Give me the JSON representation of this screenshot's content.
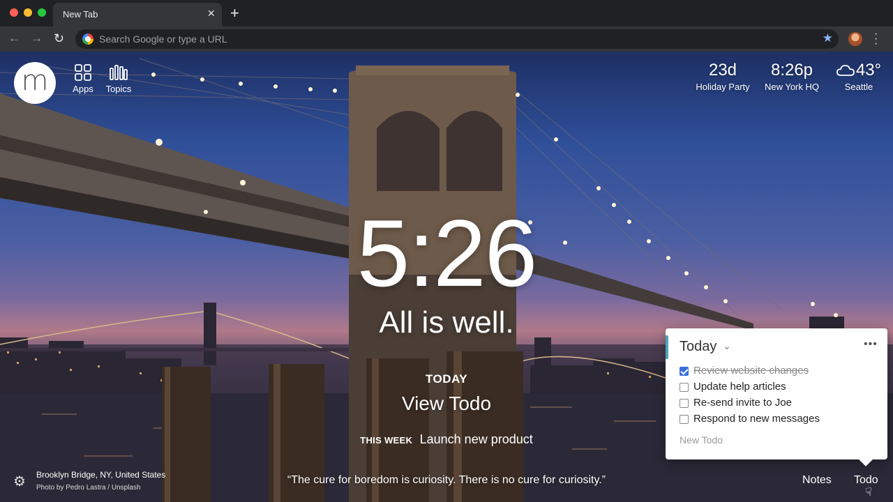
{
  "browser": {
    "tab_title": "New Tab",
    "tab_close_glyph": "×",
    "new_tab_glyph": "+",
    "omnibox_placeholder": "Search Google or type a URL",
    "star_glyph": "★"
  },
  "topnav": {
    "logo_letter": "m",
    "apps_label": "Apps",
    "topics_label": "Topics"
  },
  "widgets": {
    "countdown": {
      "value": "23d",
      "label": "Holiday Party"
    },
    "world_clock": {
      "value": "8:26p",
      "label": "New York HQ"
    },
    "weather": {
      "value": "43°",
      "label": "Seattle",
      "icon": "cloud-icon"
    }
  },
  "center": {
    "time": "5:26",
    "mantra": "All is well.",
    "focus_label": "TODAY",
    "focus_text": "View Todo",
    "week_label": "THIS WEEK",
    "week_text": "Launch new product"
  },
  "todo": {
    "list_title": "Today",
    "more_glyph": "•••",
    "items": [
      {
        "text": "Review website changes",
        "done": true
      },
      {
        "text": "Update help articles",
        "done": false
      },
      {
        "text": "Re-send invite to Joe",
        "done": false
      },
      {
        "text": "Respond to new messages",
        "done": false
      }
    ],
    "new_placeholder": "New Todo"
  },
  "footer": {
    "location": "Brooklyn Bridge, NY, United States",
    "photo_credit": "Photo by Pedro Lastra / Unsplash",
    "quote": "“The cure for boredom is curiosity. There is no cure for curiosity.”",
    "notes_label": "Notes",
    "todo_label": "Todo"
  },
  "colors": {
    "accent": "#4ea5b8",
    "checkbox": "#3a6fd8",
    "chrome_dark": "#202124",
    "chrome_toolbar": "#35363a"
  }
}
